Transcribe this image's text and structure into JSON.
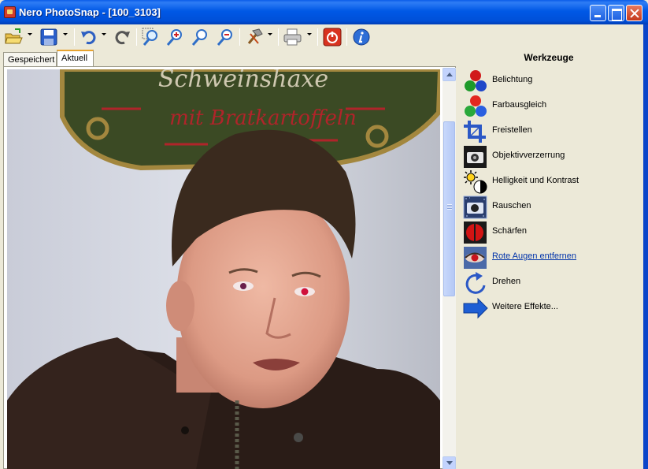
{
  "window": {
    "title": "Nero PhotoSnap - [100_3103]"
  },
  "toolbar": {
    "buttons": [
      {
        "icon": "open-folder-icon",
        "has_dropdown": true
      },
      {
        "icon": "save-disk-icon",
        "has_dropdown": true
      },
      {
        "icon": "undo-icon",
        "has_dropdown": true
      },
      {
        "icon": "redo-icon",
        "has_dropdown": false
      },
      {
        "icon": "zoom-fit-icon",
        "has_dropdown": false
      },
      {
        "icon": "zoom-in-icon",
        "has_dropdown": false
      },
      {
        "icon": "zoom-actual-icon",
        "has_dropdown": false
      },
      {
        "icon": "zoom-out-icon",
        "has_dropdown": false
      },
      {
        "icon": "hammer-tools-icon",
        "has_dropdown": true
      },
      {
        "icon": "printer-icon",
        "has_dropdown": true
      },
      {
        "icon": "power-exit-icon",
        "has_dropdown": false
      },
      {
        "icon": "info-icon",
        "has_dropdown": false
      }
    ]
  },
  "tabs": [
    {
      "label": "Gespeichert",
      "active": false
    },
    {
      "label": "Aktuell",
      "active": true
    }
  ],
  "photo": {
    "sign_text": "mit Bratkartoffeln",
    "sign_text_top": "Schweinshaxe"
  },
  "panel": {
    "title": "Werkzeuge",
    "tools": [
      {
        "label": "Belichtung",
        "icon": "rgb-balls-icon",
        "link": false
      },
      {
        "label": "Farbausgleich",
        "icon": "color-balls-icon",
        "link": false
      },
      {
        "label": "Freistellen",
        "icon": "crop-icon",
        "link": false
      },
      {
        "label": "Objektivverzerrung",
        "icon": "camera-lens-icon",
        "link": false
      },
      {
        "label": "Helligkeit und Kontrast",
        "icon": "brightness-contrast-icon",
        "link": false
      },
      {
        "label": "Rauschen",
        "icon": "noise-camera-icon",
        "link": false
      },
      {
        "label": "Schärfen",
        "icon": "sharpen-icon",
        "link": false
      },
      {
        "label": "Rote Augen entfernen",
        "icon": "red-eye-icon",
        "link": true
      },
      {
        "label": "Drehen",
        "icon": "rotate-icon",
        "link": false
      },
      {
        "label": "Weitere Effekte...",
        "icon": "arrow-right-icon",
        "link": false
      }
    ]
  },
  "colors": {
    "titlebar": "#0058E6",
    "panel_bg": "#ECE9D8",
    "link": "#0033AA",
    "tab_active_accent": "#E7A32F"
  }
}
